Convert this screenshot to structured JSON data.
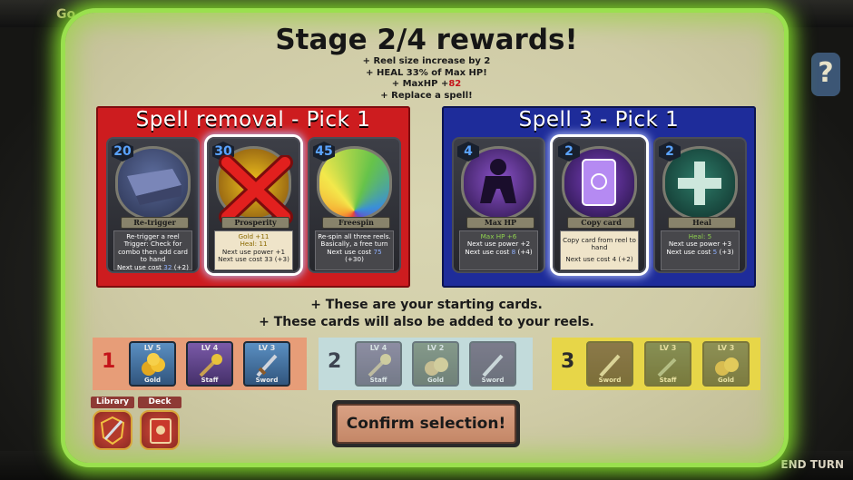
{
  "background": {
    "gold_label": "Go",
    "help_icon": "?",
    "end_turn_label": "END TURN"
  },
  "title": "Stage 2/4 rewards!",
  "rewards": [
    "+ Reel size increase by 2",
    "+ HEAL 33% of Max HP!",
    "+ MaxHP +",
    "+ Replace a spell!"
  ],
  "max_hp_bonus": "82",
  "removal": {
    "title": "Spell removal - Pick 1",
    "cards": [
      {
        "cost": "20",
        "name": "Re-trigger",
        "lines": [
          "Re-trigger a reel",
          "Trigger: Check for combo then add card to hand"
        ],
        "footer": "Next use cost",
        "footer_val": "32",
        "footer_extra": "(+2)"
      },
      {
        "cost": "30",
        "name": "Prosperity",
        "gold": "Gold +11",
        "heal": "Heal: 11",
        "lines": [
          "Next use power +1"
        ],
        "footer": "Next use cost 33 (+3)",
        "selected": true
      },
      {
        "cost": "45",
        "name": "Freespin",
        "lines": [
          "Re-spin all three reels.",
          "Basically, a free turn"
        ],
        "footer": "Next use cost",
        "footer_val": "75",
        "footer_extra": "(+30)"
      }
    ]
  },
  "spell_pick": {
    "title": "Spell 3 - Pick 1",
    "cards": [
      {
        "cost": "4",
        "name": "Max HP",
        "green": "Max HP +6",
        "lines": [
          "Next use power +2"
        ],
        "footer": "Next use cost",
        "footer_val": "8",
        "footer_extra": "(+4)"
      },
      {
        "cost": "2",
        "name": "Copy card",
        "lines": [
          "Copy card from reel to hand"
        ],
        "footer": "Next use cost 4 (+2)",
        "selected": true
      },
      {
        "cost": "2",
        "name": "Heal",
        "green": "Heal: 5",
        "lines": [
          "Next use power +3"
        ],
        "footer": "Next use cost",
        "footer_val": "5",
        "footer_extra": "(+3)"
      }
    ]
  },
  "info_lines": [
    "+ These are your starting cards.",
    "+ These cards will also be added to your reels."
  ],
  "reels": [
    {
      "number": "1",
      "slots": [
        {
          "lv": "LV 5",
          "name": "Gold"
        },
        {
          "lv": "LV 4",
          "name": "Staff"
        },
        {
          "lv": "LV 3",
          "name": "Sword"
        }
      ]
    },
    {
      "number": "2",
      "slots": [
        {
          "lv": "LV 4",
          "name": "Staff"
        },
        {
          "lv": "LV 2",
          "name": "Gold"
        },
        {
          "lv": "",
          "name": "Sword"
        }
      ]
    },
    {
      "number": "3",
      "slots": [
        {
          "lv": "",
          "name": "Sword"
        },
        {
          "lv": "LV 3",
          "name": "Staff"
        },
        {
          "lv": "LV 3",
          "name": "Gold"
        }
      ]
    }
  ],
  "library_label": "Library",
  "deck_label": "Deck",
  "confirm_label": "Confirm selection!",
  "colors": {
    "glow": "#7fd52a",
    "removal_panel": "#cd1c1f",
    "spell_panel": "#1e2c9a",
    "reel1": "#e79d78",
    "reel2": "#c2dbdb",
    "reel3": "#e7d648"
  }
}
